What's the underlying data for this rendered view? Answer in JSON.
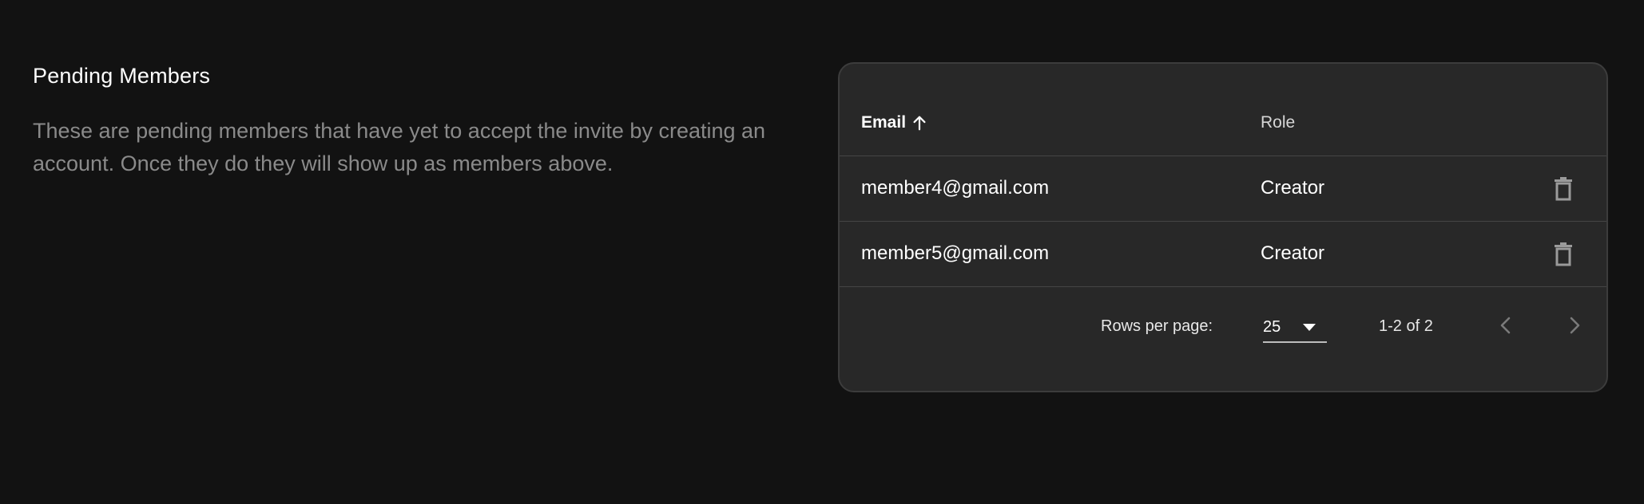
{
  "section": {
    "title": "Pending Members",
    "description": "These are pending members that have yet to accept the invite by creating an account. Once they do they will show up as members above."
  },
  "table": {
    "columns": {
      "email": "Email",
      "role": "Role"
    },
    "sort_icon": "arrow-up-icon",
    "rows": [
      {
        "email": "member4@gmail.com",
        "role": "Creator",
        "action_icon": "trash-icon"
      },
      {
        "email": "member5@gmail.com",
        "role": "Creator",
        "action_icon": "trash-icon"
      }
    ],
    "pagination": {
      "rows_per_page_label": "Rows per page:",
      "rows_per_page_value": "25",
      "range": "1-2 of 2",
      "prev_icon": "chevron-left-icon",
      "next_icon": "chevron-right-icon"
    }
  },
  "colors": {
    "background": "#121212",
    "card": "#282828",
    "border": "#3c3c3c",
    "muted_text": "#8a8a8a"
  }
}
